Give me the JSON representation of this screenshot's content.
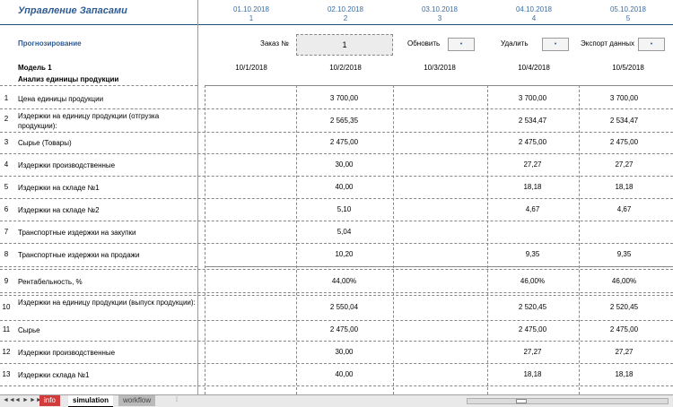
{
  "header": {
    "title": "Управление Запасами",
    "dates": [
      {
        "date": "01.10.2018",
        "num": "1"
      },
      {
        "date": "02.10.2018",
        "num": "2"
      },
      {
        "date": "03.10.2018",
        "num": "3"
      },
      {
        "date": "04.10.2018",
        "num": "4"
      },
      {
        "date": "05.10.2018",
        "num": "5"
      }
    ]
  },
  "controls": {
    "forecast_label": "Прогнозирование",
    "order_label": "Заказ №",
    "order_value": "1",
    "refresh_label": "Обновить",
    "delete_label": "Удалить",
    "export_label": "Экспорт данных",
    "button_glyph": "•"
  },
  "model": {
    "title": "Модель 1",
    "section": "Анализ единицы продукции",
    "columns": [
      "10/1/2018",
      "10/2/2018",
      "10/3/2018",
      "10/4/2018",
      "10/5/2018"
    ]
  },
  "rows": [
    {
      "num": "1",
      "label": "Цена единицы продукции",
      "values": [
        "",
        "3 700,00",
        "",
        "3 700,00",
        "3 700,00"
      ]
    },
    {
      "num": "2",
      "label": "Издержки на единицу продукции (отгрузка продукции):",
      "values": [
        "",
        "2 565,35",
        "",
        "2 534,47",
        "2 534,47"
      ]
    },
    {
      "num": "3",
      "label": "Сырье (Товары)",
      "values": [
        "",
        "2 475,00",
        "",
        "2 475,00",
        "2 475,00"
      ]
    },
    {
      "num": "4",
      "label": "Издержки производственные",
      "values": [
        "",
        "30,00",
        "",
        "27,27",
        "27,27"
      ]
    },
    {
      "num": "5",
      "label": "Издержки на складе №1",
      "values": [
        "",
        "40,00",
        "",
        "18,18",
        "18,18"
      ]
    },
    {
      "num": "6",
      "label": "Издержки на складе №2",
      "values": [
        "",
        "5,10",
        "",
        "4,67",
        "4,67"
      ]
    },
    {
      "num": "7",
      "label": "Транспортные издержки на закупки",
      "values": [
        "",
        "5,04",
        "",
        "",
        ""
      ]
    },
    {
      "num": "8",
      "label": "Транспортные издержки на продажи",
      "values": [
        "",
        "10,20",
        "",
        "9,35",
        "9,35"
      ]
    },
    {
      "num": "9",
      "label": "Рентабельность, %",
      "values": [
        "",
        "44,00%",
        "",
        "46,00%",
        "46,00%"
      ]
    },
    {
      "num": "10",
      "label": "Издержки на единицу продукции (выпуск продукции):",
      "values": [
        "",
        "2 550,04",
        "",
        "2 520,45",
        "2 520,45"
      ]
    },
    {
      "num": "11",
      "label": "Сырье",
      "values": [
        "",
        "2 475,00",
        "",
        "2 475,00",
        "2 475,00"
      ]
    },
    {
      "num": "12",
      "label": "Издержки производственные",
      "values": [
        "",
        "30,00",
        "",
        "27,27",
        "27,27"
      ]
    },
    {
      "num": "13",
      "label": "Издержки склада №1",
      "values": [
        "",
        "40,00",
        "",
        "18,18",
        "18,18"
      ]
    }
  ],
  "sheet_tabs": [
    "info",
    "simulation",
    "workflow"
  ],
  "nav": {
    "first": "◄◄",
    "prev": "◄",
    "next": "►",
    "last": "►►"
  }
}
